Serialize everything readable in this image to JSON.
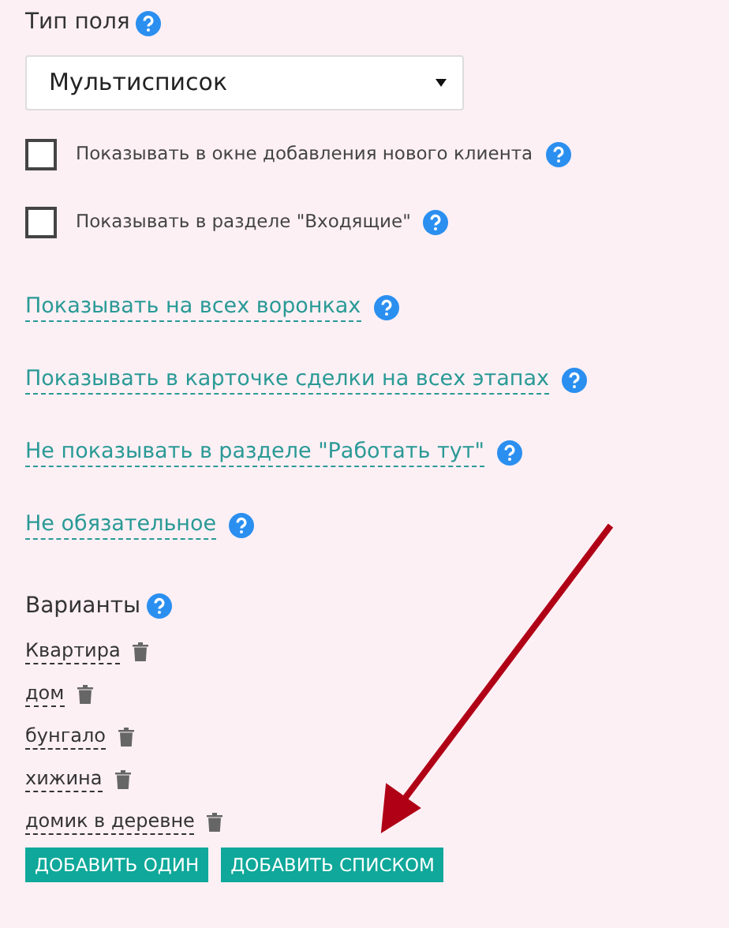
{
  "field_type": {
    "label": "Тип поля",
    "value": "Мультисписок"
  },
  "checkboxes": [
    {
      "label": "Показывать в окне добавления нового клиента",
      "checked": false
    },
    {
      "label": "Показывать в разделе \"Входящие\"",
      "checked": false
    }
  ],
  "toggle_links": [
    "Показывать на всех воронках",
    "Показывать в карточке сделки на всех этапах",
    "Не показывать в разделе \"Работать тут\"",
    "Не обязательное"
  ],
  "variants": {
    "label": "Варианты",
    "items": [
      "Квартира",
      "дом",
      "бунгало",
      "хижина",
      "домик в деревне"
    ]
  },
  "buttons": [
    "ДОБАВИТЬ ОДИН",
    "ДОБАВИТЬ СПИСКОМ"
  ]
}
